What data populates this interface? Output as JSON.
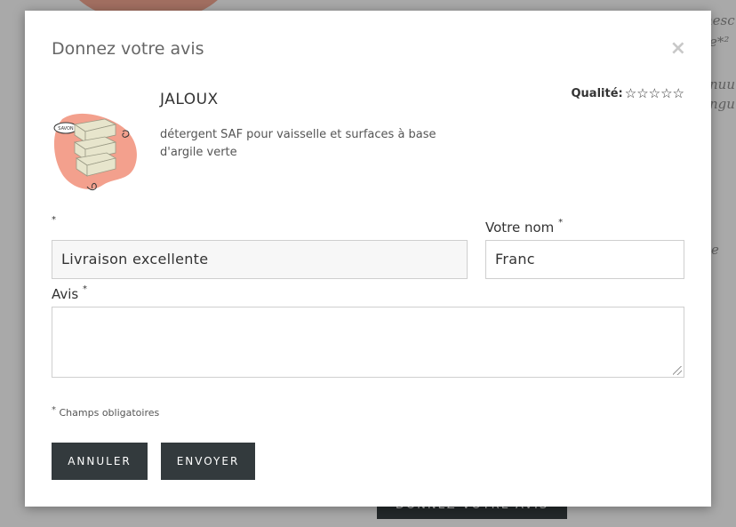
{
  "background": {
    "cta_label": "DONNEZ VOTRE AVIS",
    "snippets": [
      "nesc",
      "e*²",
      "nuu",
      "ngu",
      "e"
    ]
  },
  "modal": {
    "title": "Donnez votre avis",
    "close_icon": "close-icon"
  },
  "product": {
    "name": "JALOUX",
    "description": "détergent SAF pour vaisselle et surfaces à base d'argile verte",
    "thumb_badge": "SAVON"
  },
  "rating": {
    "label": "Qualité:",
    "max": 5,
    "value": 0,
    "star_icon": "☆"
  },
  "form": {
    "title_field": {
      "label": "",
      "required_mark": "*",
      "value": "Livraison excellente"
    },
    "name_field": {
      "label": "Votre nom",
      "required_mark": "*",
      "value": "Franc"
    },
    "review_field": {
      "label": "Avis",
      "required_mark": "*",
      "value": ""
    },
    "required_note": {
      "mark": "*",
      "text": "Champs obligatoires"
    },
    "buttons": {
      "cancel": "ANNULER",
      "submit": "ENVOYER"
    }
  },
  "colors": {
    "button_bg": "#333a3d",
    "blob": "#e9a08c"
  }
}
